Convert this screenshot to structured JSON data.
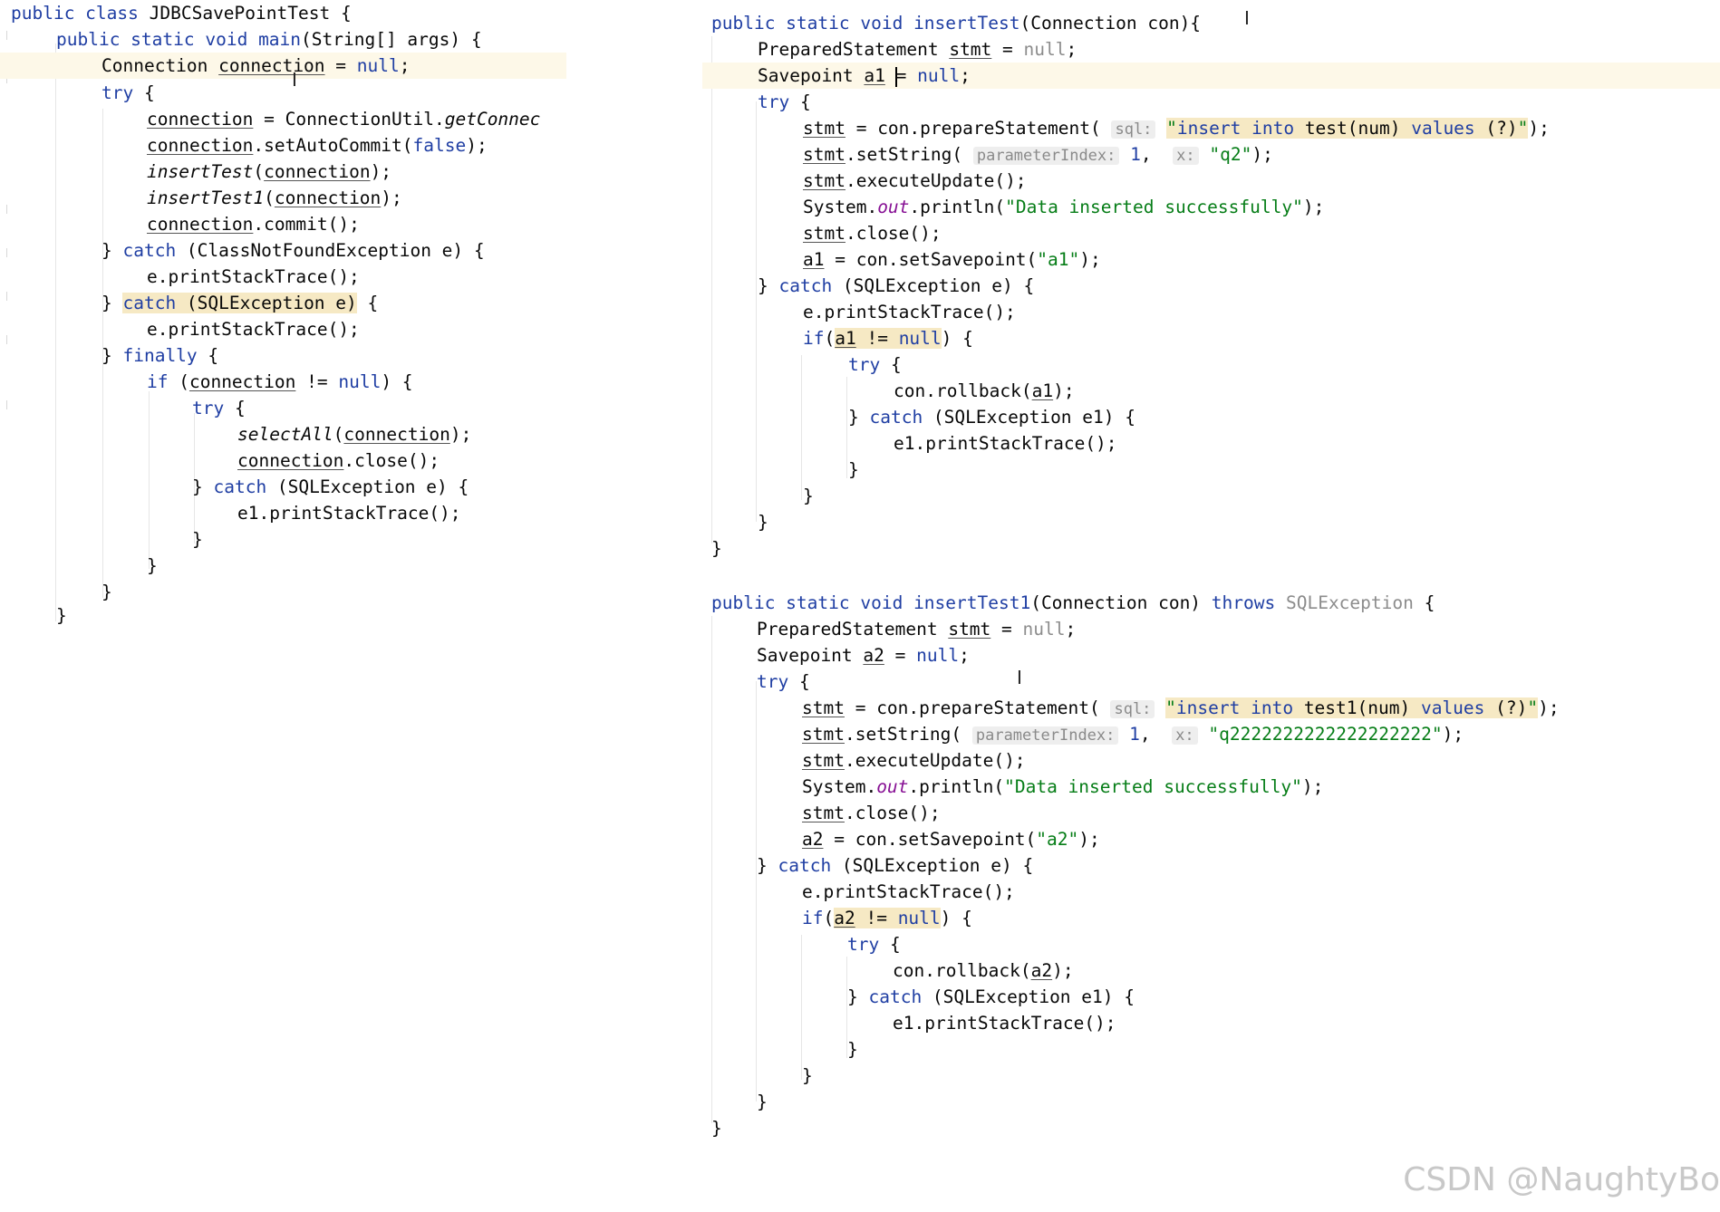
{
  "left_pane": {
    "title": "JDBCSavePointTest",
    "class_decl": "public class JDBCSavePointTest {",
    "main_decl": "public static void main(String[] args) {"
  },
  "right_pane": {
    "insert_test_method": "insertTest",
    "insert_test1_method": "insertTest1",
    "throws_clause": "SQLException"
  },
  "strings": {
    "sql1": "insert into test(num) values (?)",
    "sql2": "insert into test1(num) values (?)",
    "val1": "q2",
    "val2": "q2222222222222222222",
    "success_msg": "Data inserted successfully",
    "savepoint1": "a1",
    "savepoint2": "a2"
  },
  "hints": {
    "sql": "sql:",
    "parameter_index": "parameterIndex:",
    "x": "x:"
  },
  "watermark": "CSDN @NaughtyBo"
}
